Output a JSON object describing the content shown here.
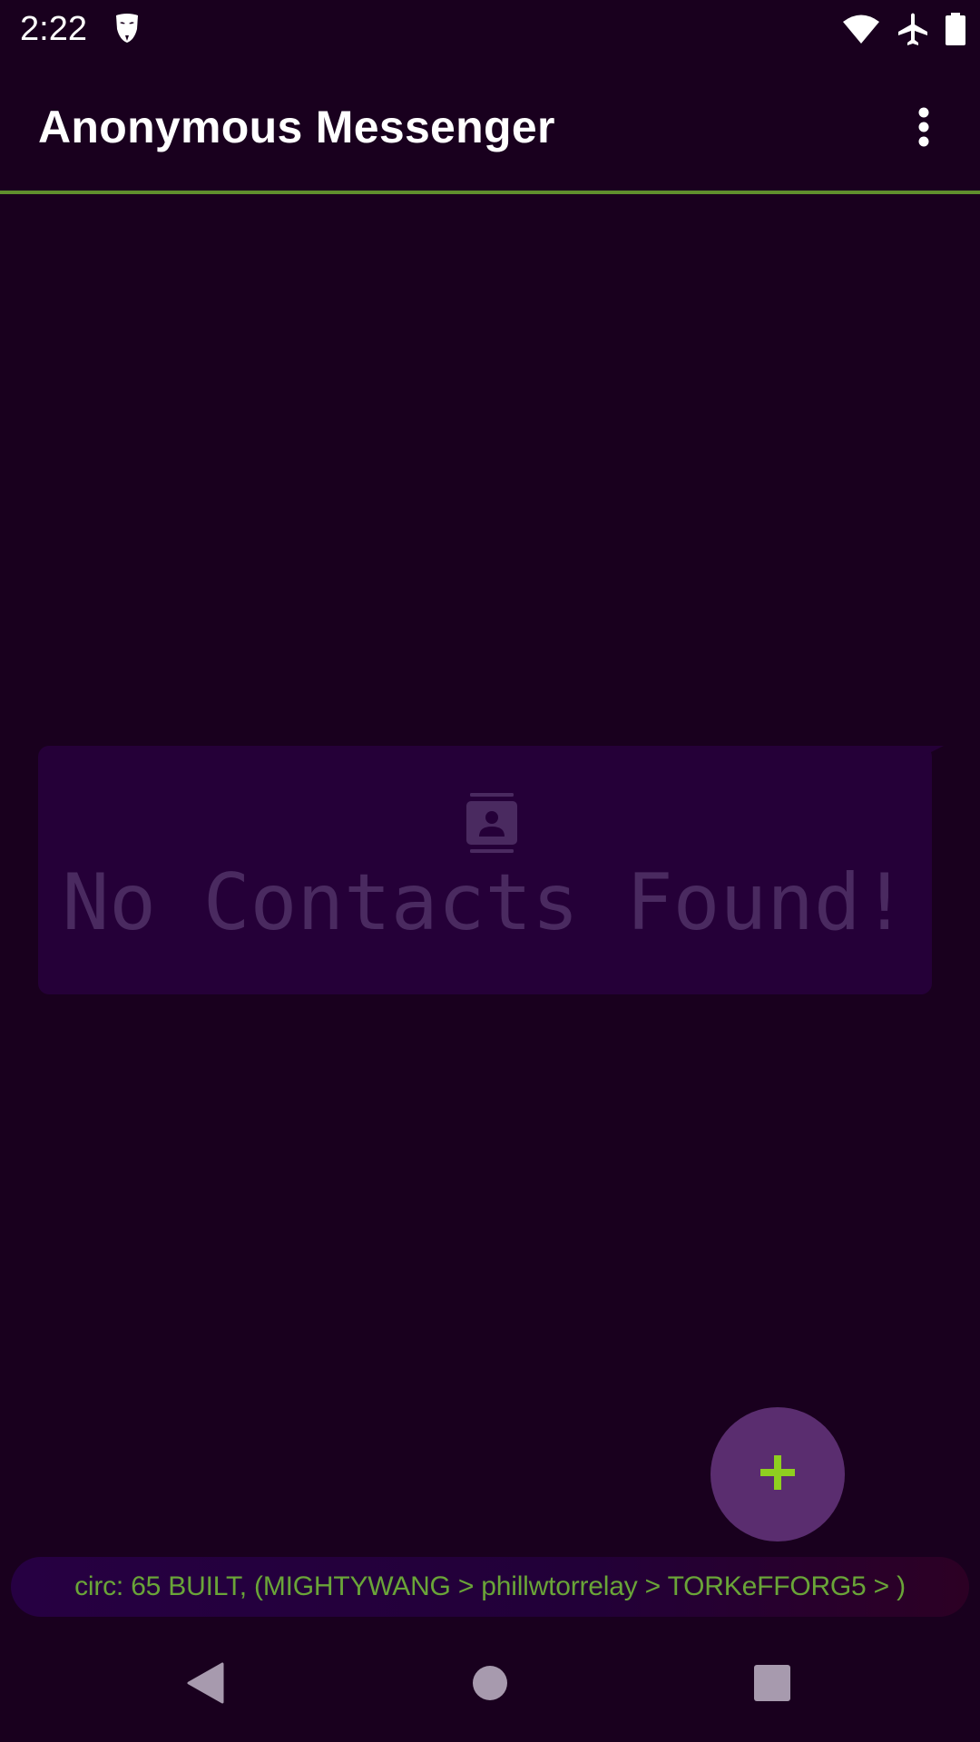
{
  "status_bar": {
    "time": "2:22",
    "app_icon": "anonymous-mask-icon",
    "icons": [
      "wifi-icon",
      "airplane-mode-icon",
      "battery-icon"
    ]
  },
  "toolbar": {
    "title": "Anonymous Messenger",
    "menu_icon": "more-vert-icon"
  },
  "empty_state": {
    "icon": "contact-card-icon",
    "message": "No Contacts Found!"
  },
  "fab": {
    "icon": "add-icon"
  },
  "circuit_status": {
    "text": "circ: 65 BUILT, (MIGHTYWANG > phillwtorrelay > TORKeFFORG5 > )"
  },
  "nav_bar": {
    "buttons": [
      "back-icon",
      "home-icon",
      "recents-icon"
    ]
  },
  "colors": {
    "background": "#19001e",
    "accent_green": "#6aa538",
    "divider_green": "#5f8f2d",
    "card": "#250038",
    "fab": "#5a2d6f",
    "muted_text": "#4a2a60"
  }
}
